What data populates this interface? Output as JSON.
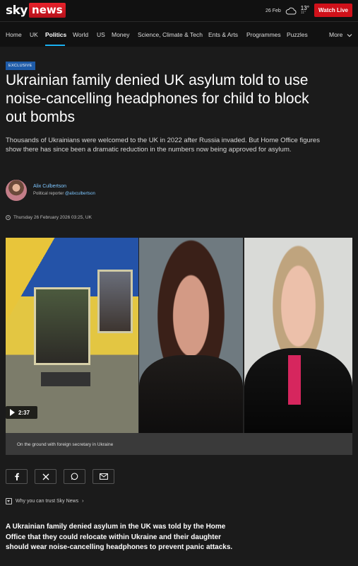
{
  "header": {
    "logo_sky": "sky",
    "logo_news": "news",
    "weather_date": "26 Feb",
    "temp_high": "13°",
    "temp_low": "11°",
    "watch_live": "Watch Live"
  },
  "nav": {
    "items": [
      "Home",
      "UK",
      "Politics",
      "World",
      "US",
      "Money",
      "Science, Climate & Tech",
      "Ents & Arts",
      "Programmes",
      "Puzzles"
    ],
    "more": "More",
    "active": "Politics"
  },
  "article": {
    "badge": "EXCLUSIVE",
    "headline": "Ukrainian family denied UK asylum told to use noise-cancelling headphones for child to block out bombs",
    "standfirst": "Thousands of Ukrainians were welcomed to the UK in 2022 after Russia invaded. But Home Office figures show there has since been a dramatic reduction in the numbers now being approved for asylum.",
    "author_name": "Alix Culbertson",
    "author_role": "Political reporter",
    "author_handle": "@alixculbertson",
    "timestamp": "Thursday 26 February 2026 03:25, UK",
    "video_duration": "2:37",
    "caption": "On the ground with foreign secretary in Ukraine",
    "trust_link": "Why you can trust Sky News",
    "body_first": "A Ukrainian family denied asylum in the UK was told by the Home Office that they could relocate within Ukraine and their daughter should wear noise-cancelling headphones to prevent panic attacks."
  },
  "share": [
    "facebook-icon",
    "x-icon",
    "whatsapp-icon",
    "email-icon"
  ],
  "colors": {
    "brand_red": "#d0111a",
    "accent_blue": "#1ab0f0",
    "badge_blue": "#1e5ba8"
  }
}
